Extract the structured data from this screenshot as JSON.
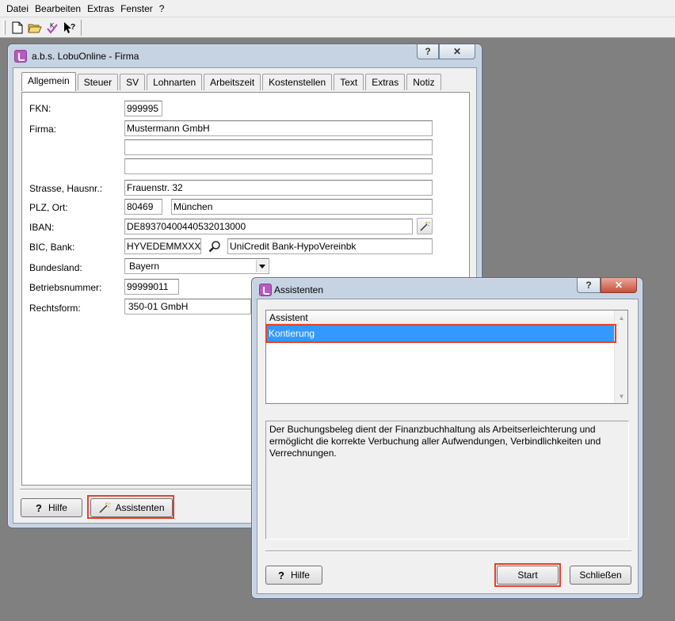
{
  "menubar": {
    "items": [
      "Datei",
      "Bearbeiten",
      "Extras",
      "Fenster",
      "?"
    ]
  },
  "toolbar": {
    "icons": [
      "new-document-icon",
      "open-folder-icon",
      "check-k-icon",
      "help-pointer-icon"
    ]
  },
  "firma_window": {
    "title": "a.b.s. LobuOnline - Firma",
    "help_caption": "?",
    "close_caption": "✕",
    "tabs": [
      "Allgemein",
      "Steuer",
      "SV",
      "Lohnarten",
      "Arbeitszeit",
      "Kostenstellen",
      "Text",
      "Extras",
      "Notiz"
    ],
    "active_tab": "Allgemein",
    "labels": {
      "fkn": "FKN:",
      "firma": "Firma:",
      "strasse": "Strasse, Hausnr.:",
      "plz_ort": "PLZ, Ort:",
      "iban": "IBAN:",
      "bic_bank": "BIC, Bank:",
      "bundesland": "Bundesland:",
      "betriebsnummer": "Betriebsnummer:",
      "rechtsform": "Rechtsform:"
    },
    "values": {
      "fkn": "999995",
      "firma1": "Mustermann GmbH",
      "firma2": "",
      "firma3": "",
      "strasse": "Frauenstr. 32",
      "plz": "80469",
      "ort": "München",
      "iban": "DE89370400440532013000",
      "bic": "HYVEDEMMXXX",
      "bank": "UniCredit Bank-HypoVereinbk",
      "bundesland": "Bayern",
      "betriebsnummer": "99999011",
      "rechtsform": "350-01 GmbH"
    },
    "buttons": {
      "hilfe_icon": "?",
      "hilfe": "Hilfe",
      "assistenten": "Assistenten"
    }
  },
  "assistenten_dialog": {
    "title": "Assistenten",
    "help_caption": "?",
    "close_caption": "✕",
    "list": {
      "header": "Assistent",
      "rows": [
        "Kontierung"
      ],
      "selected": "Kontierung"
    },
    "description": "Der Buchungsbeleg dient der Finanzbuchhaltung als Arbeitserleichterung und ermöglicht die korrekte Verbuchung aller Aufwendungen, Verbindlichkeiten und Verrechnungen.",
    "buttons": {
      "hilfe_icon": "?",
      "hilfe": "Hilfe",
      "start": "Start",
      "schliessen": "Schließen"
    }
  },
  "colors": {
    "desktop": "#808080",
    "highlight": "#e8402a",
    "selection": "#3399ff",
    "app_icon": "#b65bbf"
  }
}
